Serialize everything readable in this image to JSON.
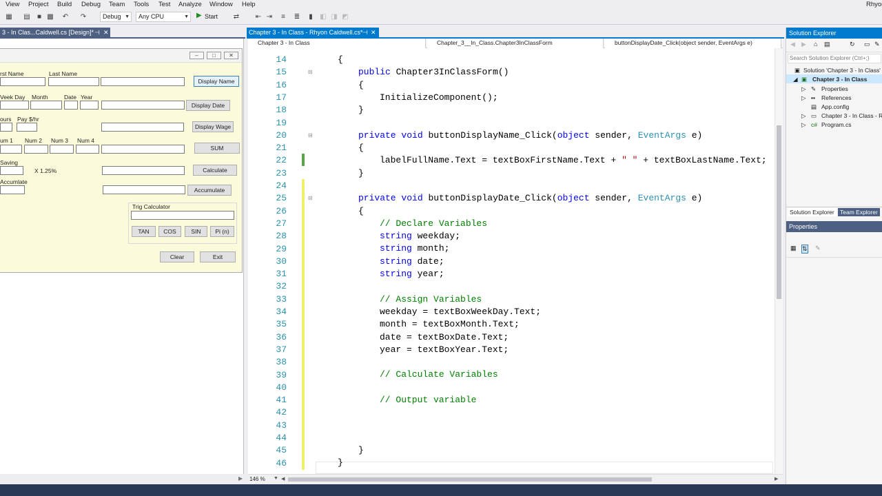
{
  "menu": [
    "View",
    "Project",
    "Build",
    "Debug",
    "Team",
    "Tools",
    "Test",
    "Analyze",
    "Window",
    "Help"
  ],
  "user_name": "Rhyon",
  "toolbar": {
    "config": "Debug",
    "platform": "Any CPU",
    "start_label": "Start"
  },
  "designer_tab": {
    "title": "3 - In Clas...Caldwell.cs [Design]*"
  },
  "form": {
    "labels": {
      "first_name": "rst Name",
      "last_name": "Last Name",
      "weekday": "Veek Day",
      "month": "Month",
      "date": "Date",
      "year": "Year",
      "hours": "ours",
      "pay": "Pay $/hr",
      "num1": "um 1",
      "num2": "Num 2",
      "num3": "Num 3",
      "num4": "Num 4",
      "saving": "Saving",
      "rate": "X 1.25%",
      "accumulate": "Accumlate",
      "trig": "Trig Calculator"
    },
    "buttons": {
      "display_name": "Display Name",
      "display_date": "Display Date",
      "display_wage": "Display Wage",
      "sum": "SUM",
      "calculate": "Calculate",
      "accumulate": "Accumulate",
      "tan": "TAN",
      "cos": "COS",
      "sin": "SIN",
      "pi": "Pi (n)",
      "clear": "Clear",
      "exit": "Exit"
    }
  },
  "editor_tab": {
    "title": "Chapter 3 - In Class - Rhyon Caldwell.cs*"
  },
  "nav": {
    "project": "Chapter 3 - In Class",
    "class": "Chapter_3__In_Class.Chapter3InClassForm",
    "member": "buttonDisplayDate_Click(object sender, EventArgs e)"
  },
  "code": {
    "line_numbers": [
      "14",
      "15",
      "16",
      "17",
      "18",
      "19",
      "20",
      "21",
      "22",
      "23",
      "24",
      "25",
      "26",
      "27",
      "28",
      "29",
      "30",
      "31",
      "32",
      "33",
      "34",
      "35",
      "36",
      "37",
      "38",
      "39",
      "40",
      "41",
      "42",
      "43",
      "44",
      "45",
      "46"
    ],
    "ctor_name": "Chapter3InClassForm()",
    "init_call": "InitializeComponent();",
    "handler1": "buttonDisplayName_Click(",
    "handler1_body": "labelFullName.Text = textBoxFirstName.Text + ",
    "string_literal": "\" \"",
    "handler1_tail": " + textBoxLastName.Text;",
    "handler2": "buttonDisplayDate_Click(",
    "comment_declare": "// Declare Variables",
    "var_weekday": " weekday;",
    "var_month": " month;",
    "var_date": " date;",
    "var_year": " year;",
    "comment_assign": "// Assign Variables",
    "assign_weekday": "weekday = textBoxWeekDay.Text;",
    "assign_month": "month = textBoxMonth.Text;",
    "assign_date": "date = textBoxDate.Text;",
    "assign_year": "year = textBoxYear.Text;",
    "comment_calc": "// Calculate Variables",
    "comment_output": "// Output variable"
  },
  "zoom": "146 %",
  "solution": {
    "title": "Solution Explorer",
    "search_placeholder": "Search Solution Explorer (Ctrl+;)",
    "items": [
      "Solution 'Chapter 3 - In Class'",
      "Chapter 3 - In Class",
      "Properties",
      "References",
      "App.config",
      "Chapter 3 - In Class - R",
      "Program.cs"
    ],
    "tab_solution": "Solution Explorer",
    "tab_team": "Team Explorer",
    "properties_title": "Properties"
  },
  "colors": {
    "accent": "#007acc",
    "tab_active": "#007acc",
    "tab_inactive": "#4d6082",
    "form_bg": "#fbfbdc"
  }
}
